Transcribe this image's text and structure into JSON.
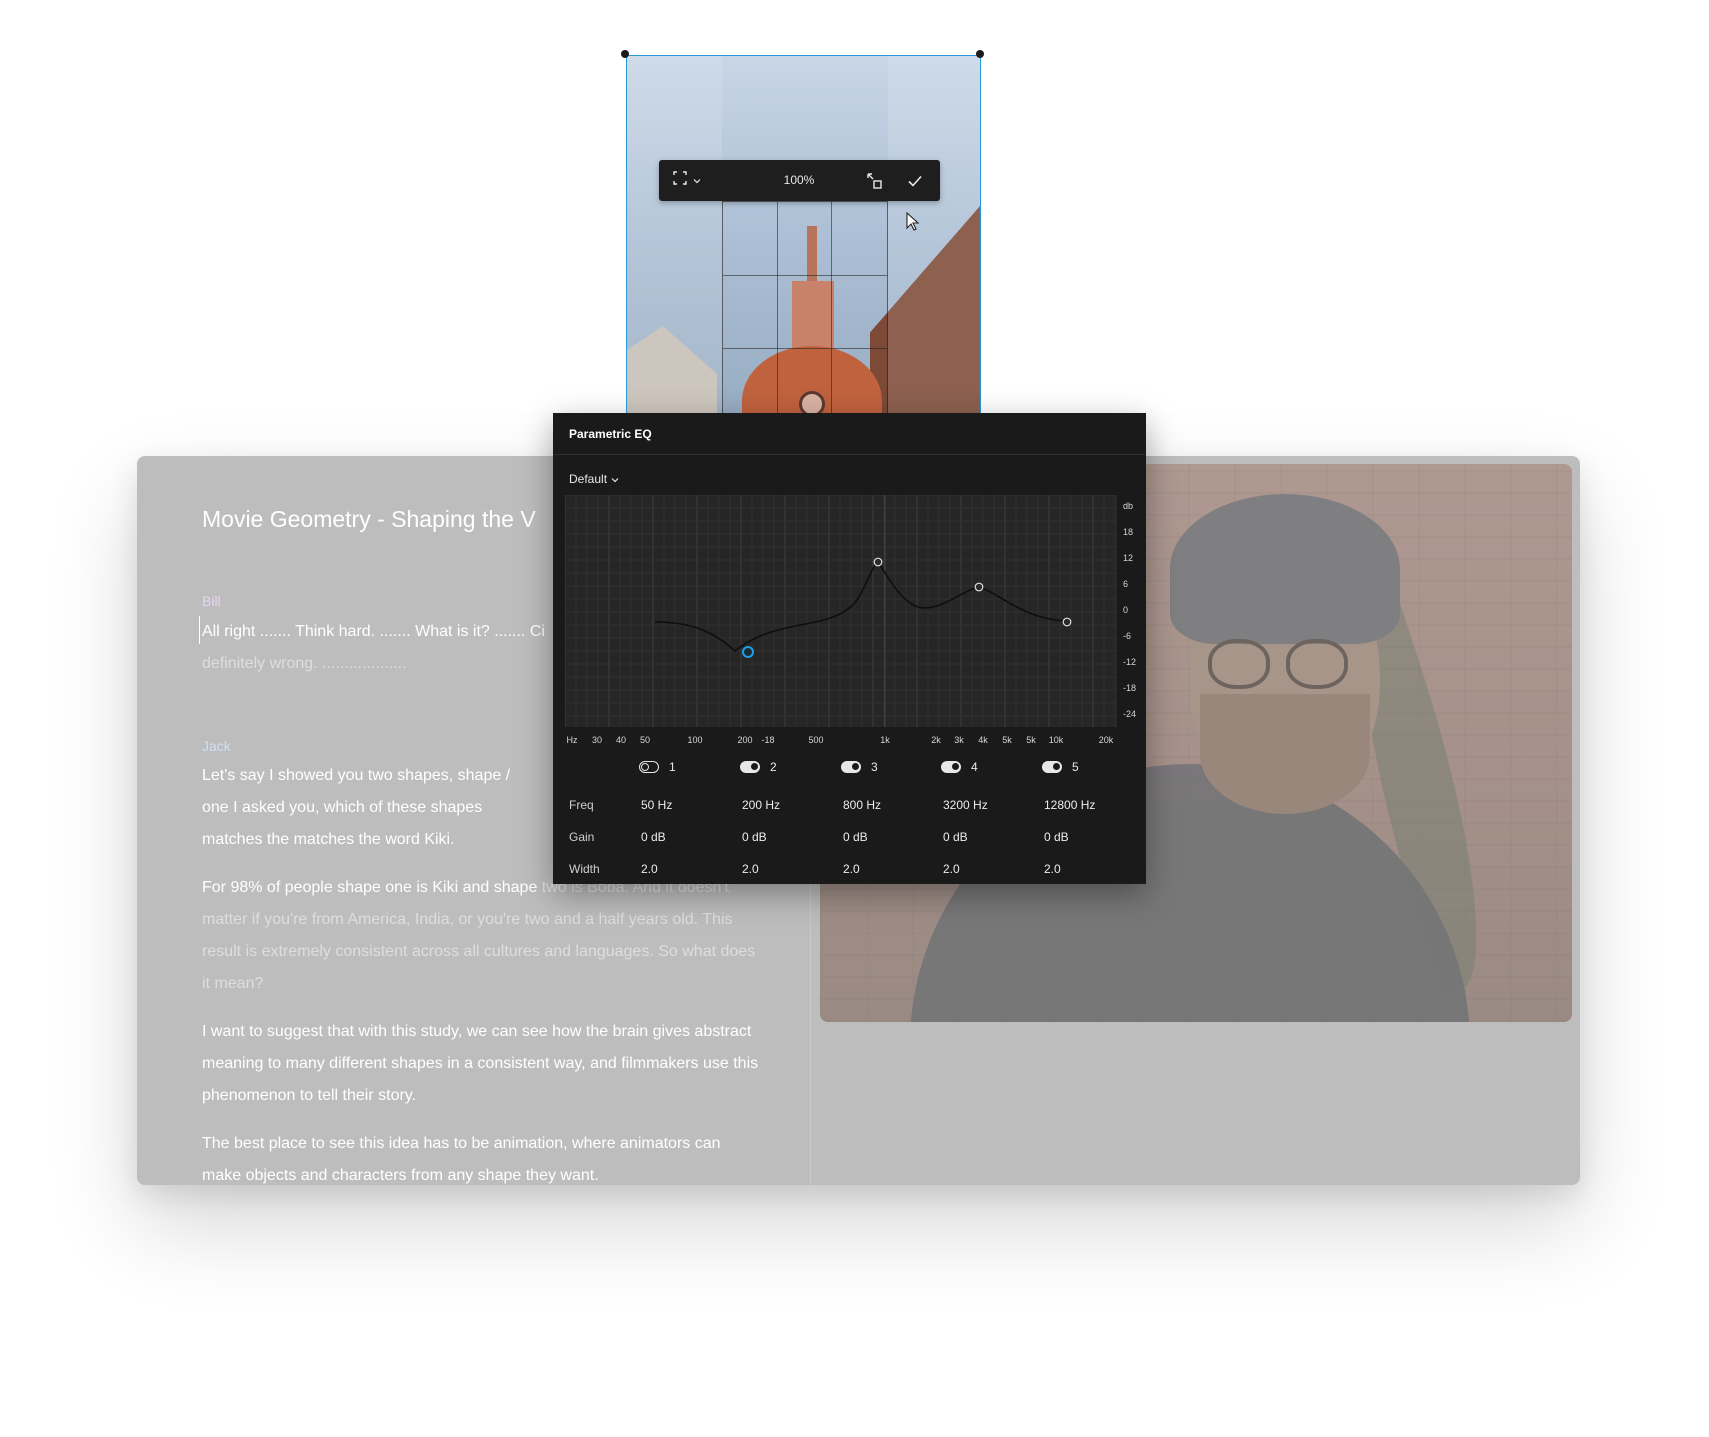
{
  "transcript": {
    "title": "Movie Geometry - Shaping the V",
    "entries": [
      {
        "speaker": "Bill",
        "paragraphs": [
          {
            "text": "All right ....... Think hard. ....... What is it? ....... Ci",
            "dim": "definitely wrong. ..................."
          }
        ]
      },
      {
        "speaker": "Jack",
        "paragraphs": [
          {
            "text": "Let's say I showed you two shapes, shape / one I asked you, which of these shapes matches the matches the word Kiki.",
            "dim": ""
          },
          {
            "text": "For 98% of people shape one is Kiki and shape ",
            "dim": "two is Boba. And it doesn't matter if you're from America, India, or you're two and a half years old. This result is extremely consistent across all cultures and languages. So what does it mean?"
          },
          {
            "text": "  I want to suggest that with this study, we can see how the brain gives abstract meaning to many different shapes in a consistent way, and filmmakers use this phenomenon to tell their story.",
            "dim": ""
          },
          {
            "text": "  The best place to see this idea has to be animation, where animators can make objects and characters from any shape they want.",
            "dim": ""
          }
        ]
      }
    ]
  },
  "crop_toolbar": {
    "zoom": "100%",
    "expand_icon": "fullscreen-icon",
    "reset_icon": "reset-crop-icon",
    "confirm_icon": "checkmark-icon"
  },
  "eq": {
    "title": "Parametric EQ",
    "preset": "Default",
    "y_axis": {
      "unit": "db",
      "ticks": [
        "18",
        "12",
        "6",
        "0",
        "-6",
        "-12",
        "-18",
        "-24"
      ]
    },
    "x_axis": {
      "unit": "Hz",
      "ticks": [
        "30",
        "40",
        "50",
        "100",
        "200",
        "-18",
        "500",
        "1k",
        "2k",
        "3k",
        "4k",
        "5k",
        "5k",
        "10k",
        "20k"
      ]
    },
    "row_labels": {
      "freq": "Freq",
      "gain": "Gain",
      "width": "Width"
    },
    "bands": [
      {
        "num": "1",
        "enabled": false,
        "freq": "50 Hz",
        "gain": "0 dB",
        "width": "2.0"
      },
      {
        "num": "2",
        "enabled": true,
        "freq": "200 Hz",
        "gain": "0 dB",
        "width": "2.0"
      },
      {
        "num": "3",
        "enabled": true,
        "freq": "800 Hz",
        "gain": "0 dB",
        "width": "2.0"
      },
      {
        "num": "4",
        "enabled": true,
        "freq": "3200 Hz",
        "gain": "0 dB",
        "width": "2.0"
      },
      {
        "num": "5",
        "enabled": true,
        "freq": "12800 Hz",
        "gain": "0 dB",
        "width": "2.0"
      }
    ],
    "colors": {
      "background": "#1a1a1a",
      "selected_node": "#1ea1e8",
      "grid": "#3a3a3a"
    }
  }
}
